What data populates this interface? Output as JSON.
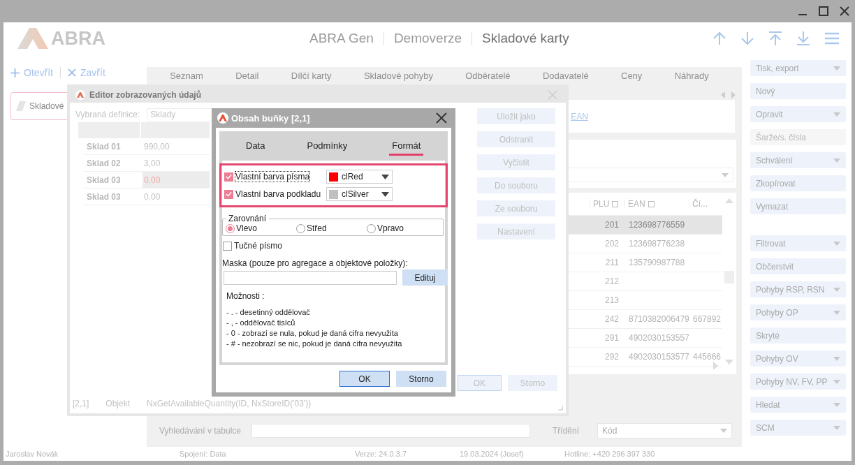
{
  "header": {
    "logo": "ABRA",
    "breadcrumb": [
      "ABRA Gen",
      "Demoverze",
      "Skladové karty"
    ]
  },
  "left_panel": {
    "actions": [
      {
        "kind": "open",
        "label": "Otevřít"
      },
      {
        "kind": "close",
        "label": "Zavřít"
      }
    ],
    "card": "Skladové"
  },
  "tabs": [
    "Seznam",
    "Detail",
    "Dílčí karty",
    "Skladové pohyby",
    "Odběratelé",
    "Dodavatelé",
    "Ceny",
    "Náhrady"
  ],
  "links": [
    "EAN"
  ],
  "table": {
    "columns": [
      "PLU",
      "EAN",
      "Čí..."
    ],
    "rows": [
      {
        "cells": [
          "201",
          "123698776559"
        ],
        "selected": true
      },
      {
        "cells": [
          "202",
          "123698776238"
        ],
        "selected": false
      },
      {
        "cells": [
          "211",
          "135790987788"
        ],
        "selected": false
      },
      {
        "cells": [
          "212"
        ],
        "selected": false
      },
      {
        "cells": [
          "213"
        ],
        "selected": false
      },
      {
        "cells": [
          "242",
          "8710382006479",
          "667892"
        ],
        "selected": false
      },
      {
        "cells": [
          "291",
          "4902030153557"
        ],
        "selected": false
      },
      {
        "cells": [
          "292",
          "4902030153577",
          "445666"
        ],
        "selected": false
      }
    ]
  },
  "sidebar": {
    "groups": [
      [
        {
          "label": "Tisk, export",
          "kind": "dropdown",
          "disabled": false
        },
        {
          "label": "Nový",
          "kind": "button",
          "disabled": false
        },
        {
          "label": "Opravit",
          "kind": "dropdown",
          "disabled": false
        },
        {
          "label": "Šarže/s. čísla",
          "kind": "button",
          "disabled": true
        },
        {
          "label": "Schválení",
          "kind": "dropdown",
          "disabled": false
        },
        {
          "label": "Zkopírovat",
          "kind": "button",
          "disabled": false
        },
        {
          "label": "Vymazat",
          "kind": "button",
          "disabled": false
        }
      ],
      [
        {
          "label": "Filtrovat",
          "kind": "dropdown",
          "disabled": false
        },
        {
          "label": "Občerstvit",
          "kind": "button",
          "disabled": false
        },
        {
          "label": "Pohyby RSP, RSN",
          "kind": "dropdown",
          "disabled": false
        },
        {
          "label": "Pohyby OP",
          "kind": "dropdown",
          "disabled": false
        },
        {
          "label": "Skryté",
          "kind": "button",
          "disabled": false
        },
        {
          "label": "Pohyby OV",
          "kind": "dropdown",
          "disabled": false
        },
        {
          "label": "Pohyby NV, FV, PP",
          "kind": "dropdown",
          "disabled": false
        },
        {
          "label": "Hledat",
          "kind": "dropdown",
          "disabled": false
        },
        {
          "label": "SCM",
          "kind": "dropdown",
          "disabled": false
        }
      ]
    ]
  },
  "search": {
    "label": "Vyhledávání v tabulce",
    "sort_label": "Třídění",
    "sort_value": "Kód"
  },
  "status_bar": [
    "Jaroslav Novák",
    "Spojení: Data",
    "Verze: 24.0.3.7",
    "19.03.2024 (Josef)",
    "Hotline: +420 296 397 330"
  ],
  "editor": {
    "title": "Editor zobrazovaných údajů",
    "definition_label": "Vybraná definice:",
    "definition_value": "Sklady",
    "rows": [
      {
        "name": "Sklad 01",
        "value": "990,00",
        "selected": false
      },
      {
        "name": "Sklad 02",
        "value": "3,00",
        "selected": false
      },
      {
        "name": "Sklad 03",
        "value": "0,00",
        "selected": true
      },
      {
        "name": "Sklad 03",
        "value": "0,00",
        "selected": false
      }
    ],
    "buttons": [
      "Uložit jako",
      "Odstranit",
      "Vyčistit",
      "Do souboru",
      "Ze souboru",
      "Nastavení"
    ],
    "footer_buttons": [
      {
        "label": "OK",
        "primary": true
      },
      {
        "label": "Storno",
        "primary": false
      }
    ],
    "status": [
      "[2,1]",
      "Objekt",
      "NxGetAvailableQuantity(ID, NxStoreID('03'))"
    ]
  },
  "cell_dialog": {
    "title": "Obsah buňky [2,1]",
    "tabs": [
      {
        "label": "Data",
        "selected": false
      },
      {
        "label": "Podmínky",
        "selected": false
      },
      {
        "label": "Formát",
        "selected": true
      }
    ],
    "color_options": [
      {
        "label": "Vlastní barva písma",
        "checked": true,
        "focused": true,
        "value": "clRed",
        "color": "#ff0000"
      },
      {
        "label": "Vlastní barva podkladu",
        "checked": true,
        "focused": false,
        "value": "clSilver",
        "color": "#c0c0c0"
      }
    ],
    "alignment": {
      "label": "Zarovnání",
      "options": [
        {
          "label": "Vlevo",
          "selected": true
        },
        {
          "label": "Střed",
          "selected": false
        },
        {
          "label": "Vpravo",
          "selected": false
        }
      ]
    },
    "bold": {
      "label": "Tučné písmo",
      "checked": false
    },
    "mask": {
      "label": "Maska (pouze pro agregace a objektové položky):",
      "button": "Edituj"
    },
    "options_title": "Možnosti :",
    "options": [
      "- . - desetinný oddělovač",
      "- , - oddělovač tisíců",
      "- 0 - zobrazí se nula, pokud je daná cifra nevyužita",
      "- # - nezobrazí se nic, pokud je daná cifra nevyužita"
    ],
    "buttons": [
      {
        "label": "OK",
        "primary": true
      },
      {
        "label": "Storno",
        "primary": false
      }
    ]
  }
}
